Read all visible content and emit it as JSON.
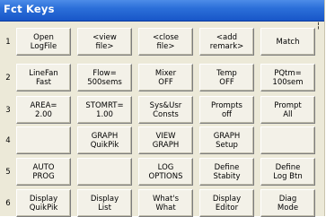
{
  "window": {
    "title": "Fct Keys",
    "edge_glyph": "¦"
  },
  "rows": [
    {
      "number": "1",
      "keys": [
        "Open\nLogFile",
        "<view\nfile>",
        "<close\nfile>",
        "<add\nremark>",
        "Match"
      ]
    },
    {
      "number": "2",
      "keys": [
        "LineFan\nFast",
        "Flow=\n500sems",
        "Mixer\nOFF",
        "Temp\nOFF",
        "PQtm=\n100sem"
      ]
    },
    {
      "number": "3",
      "keys": [
        "AREA=\n2.00",
        "STOMRT=\n1.00",
        "Sys&Usr\nConsts",
        "Prompts\noff",
        "Prompt\nAll"
      ]
    },
    {
      "number": "4",
      "keys": [
        "",
        "GRAPH\nQuikPik",
        "VIEW\nGRAPH",
        "GRAPH\nSetup",
        ""
      ]
    },
    {
      "number": "5",
      "keys": [
        "AUTO\nPROG",
        "",
        "LOG\nOPTIONS",
        "Define\nStabity",
        "Define\nLog Btn"
      ]
    },
    {
      "number": "6",
      "keys": [
        "Display\nQuikPik",
        "Display\nList",
        "What's\nWhat",
        "Display\nEditor",
        "Diag\nMode"
      ]
    }
  ]
}
